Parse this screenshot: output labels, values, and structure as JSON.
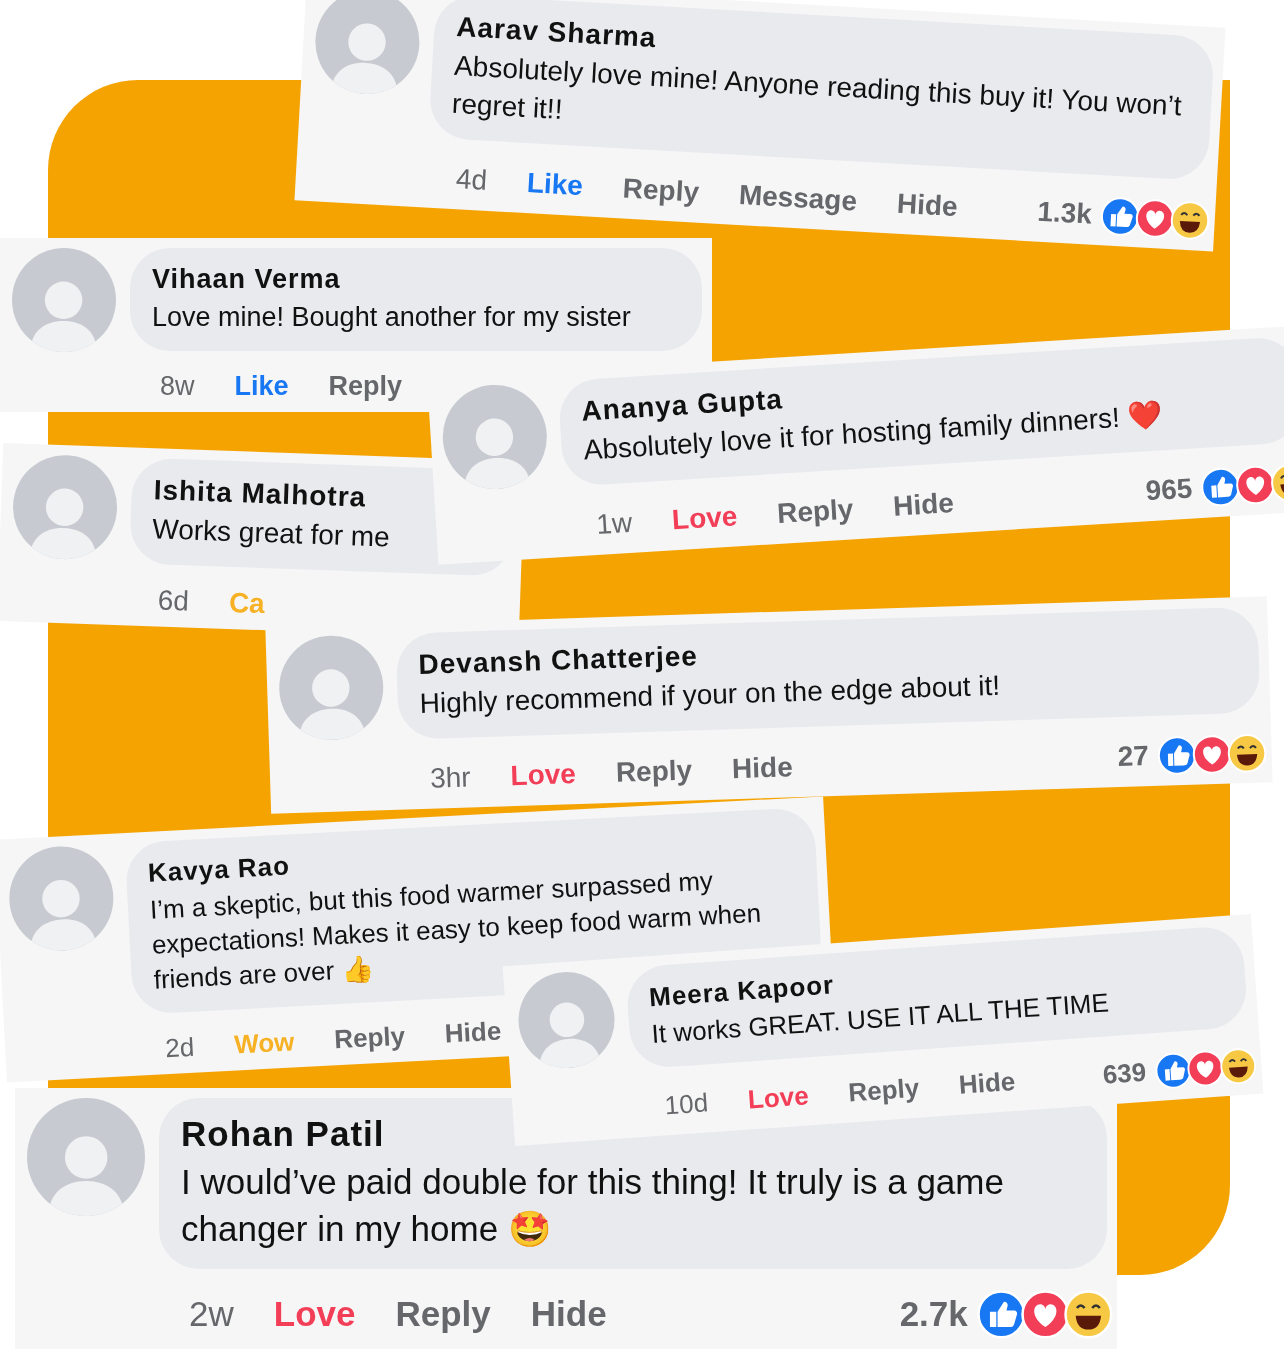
{
  "comments": [
    {
      "name": "Aarav Sharma",
      "text": "Absolutely love mine! Anyone reading this buy it! You won’t regret it!!",
      "time": "4d",
      "actions": [
        {
          "label": "Like",
          "kind": "like"
        },
        {
          "label": "Reply",
          "kind": "plain"
        },
        {
          "label": "Message",
          "kind": "plain"
        },
        {
          "label": "Hide",
          "kind": "plain"
        }
      ],
      "count": "1.3k"
    },
    {
      "name": "Vihaan Verma",
      "text": "Love mine! Bought another for my sister",
      "time": "8w",
      "actions": [
        {
          "label": "Like",
          "kind": "like"
        },
        {
          "label": "Reply",
          "kind": "plain"
        }
      ]
    },
    {
      "name": "Ananya Gupta",
      "text": "Absolutely love it for hosting family dinners! ❤️",
      "time": "1w",
      "actions": [
        {
          "label": "Love",
          "kind": "love"
        },
        {
          "label": "Reply",
          "kind": "plain"
        },
        {
          "label": "Hide",
          "kind": "plain"
        }
      ],
      "count": "965"
    },
    {
      "name": "Ishita Malhotra",
      "text": "Works great for me",
      "time": "6d",
      "actions": [
        {
          "label": "Ca",
          "kind": "wow"
        }
      ]
    },
    {
      "name": "Devansh Chatterjee",
      "text": "Highly recommend if your on the edge about it!",
      "time": "3hr",
      "actions": [
        {
          "label": "Love",
          "kind": "love"
        },
        {
          "label": "Reply",
          "kind": "plain"
        },
        {
          "label": "Hide",
          "kind": "plain"
        }
      ],
      "count": "27"
    },
    {
      "name": "Kavya Rao",
      "text": "I’m a skeptic, but this food warmer surpassed my expectations! Makes it easy to keep food warm when friends are over 👍",
      "time": "2d",
      "actions": [
        {
          "label": "Wow",
          "kind": "wow"
        },
        {
          "label": "Reply",
          "kind": "plain"
        },
        {
          "label": "Hide",
          "kind": "plain"
        }
      ]
    },
    {
      "name": "Meera Kapoor",
      "text": "It works GREAT. USE IT ALL THE TIME",
      "time": "10d",
      "actions": [
        {
          "label": "Love",
          "kind": "love"
        },
        {
          "label": "Reply",
          "kind": "plain"
        },
        {
          "label": "Hide",
          "kind": "plain"
        }
      ],
      "count": "639"
    },
    {
      "name": "Rohan Patil",
      "text": "I would’ve paid double for this thing! It truly is a game changer in my home 🤩",
      "time": "2w",
      "actions": [
        {
          "label": "Love",
          "kind": "love"
        },
        {
          "label": "Reply",
          "kind": "plain"
        },
        {
          "label": "Hide",
          "kind": "plain"
        }
      ],
      "count": "2.7k"
    }
  ]
}
